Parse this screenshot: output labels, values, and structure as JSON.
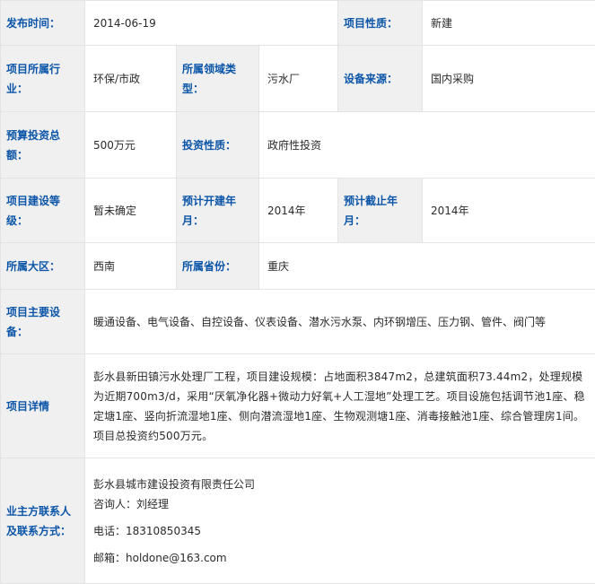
{
  "rows": {
    "publish": {
      "label": "发布时间：",
      "value": "2014-06-19",
      "label2": "项目性质：",
      "value2": "新建"
    },
    "industry": {
      "label": "项目所属行业：",
      "value": "环保/市政",
      "label2": "所属领域类型：",
      "value2": "污水厂",
      "label3": "设备来源：",
      "value3": "国内采购"
    },
    "budget": {
      "label": "预算投资总额：",
      "value": "500万元",
      "label2": "投资性质：",
      "value2": "政府性投资"
    },
    "grade": {
      "label": "项目建设等级：",
      "value": "暂未确定",
      "label2": "预计开建年月：",
      "value2": "2014年",
      "label3": "预计截止年月：",
      "value3": "2014年"
    },
    "region": {
      "label": "所属大区：",
      "value": "西南",
      "label2": "所属省份：",
      "value2": "重庆"
    },
    "equipment": {
      "label": "项目主要设备：",
      "value": "暖通设备、电气设备、自控设备、仪表设备、潜水污水泵、内环钢增压、压力钢、管件、阀门等"
    },
    "detail": {
      "label": "项目详情",
      "value": "彭水县新田镇污水处理厂工程，项目建设规模：占地面积3847m2，总建筑面积73.44m2，处理规模为近期700m3/d，采用“厌氧净化器+微动力好氧+人工湿地”处理工艺。项目设施包括调节池1座、稳定塘1座、竖向折流湿地1座、侧向潜流湿地1座、生物观测塘1座、消毒接触池1座、综合管理房1间。项目总投资约500万元。"
    },
    "contact": {
      "label": "业主方联系人及联系方式：",
      "company": "彭水县城市建设投资有限责任公司",
      "consultant": "咨询人：刘经理",
      "phone": "电话：18310850345",
      "email": "邮箱：holdone@163.com"
    }
  }
}
